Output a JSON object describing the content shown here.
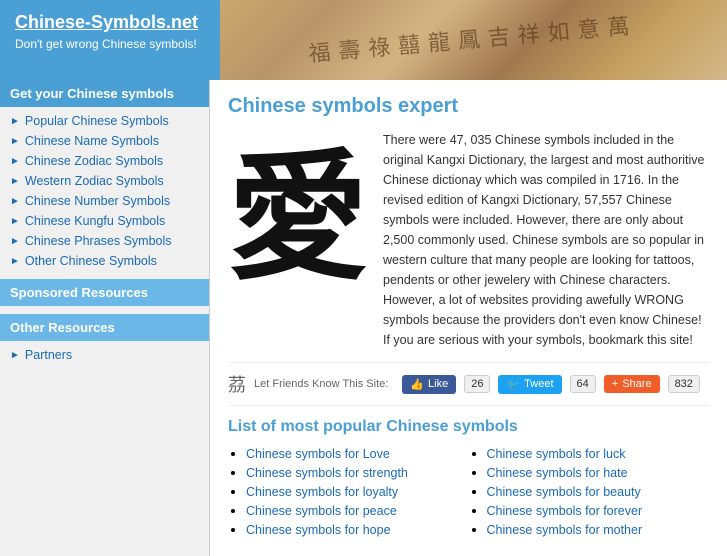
{
  "header": {
    "site_title": "Chinese-Symbols.net",
    "site_tagline": "Don't get wrong Chinese symbols!",
    "banner_chars": "福壽祿囍龍鳳吉祥如意萬"
  },
  "sidebar": {
    "nav_header": "Get your Chinese symbols",
    "nav_items": [
      {
        "label": "Popular Chinese Symbols"
      },
      {
        "label": "Chinese Name Symbols"
      },
      {
        "label": "Chinese Zodiac Symbols"
      },
      {
        "label": "Western Zodiac Symbols"
      },
      {
        "label": "Chinese Number Symbols"
      },
      {
        "label": "Chinese Kungfu Symbols"
      },
      {
        "label": "Chinese Phrases Symbols"
      },
      {
        "label": "Other Chinese Symbols"
      }
    ],
    "sponsored_header": "Sponsored Resources",
    "other_header": "Other Resources",
    "other_items": [
      {
        "label": "Partners"
      }
    ]
  },
  "main": {
    "page_title": "Chinese symbols expert",
    "description": "There were 47, 035 Chinese symbols included in the original Kangxi Dictionary, the largest and most authoritive Chinese dictionay which was compiled in 1716. In the revised edition of Kangxi Dictionary, 57,557 Chinese symbols were included. However, there are only about 2,500 commonly used. Chinese symbols are so popular in western culture that many people are looking for tattoos, pendents or other jewelery with Chinese characters. However, a lot of websites providing awefully WRONG symbols because the providers don't even know Chinese! If you are serious with your symbols, bookmark this site!",
    "chinese_char": "愛",
    "social": {
      "char": "茘",
      "label": "Let Friends Know This Site:",
      "like_label": "Like",
      "like_count": "26",
      "tweet_label": "Tweet",
      "tweet_count": "64",
      "share_label": "Share",
      "share_count": "832"
    },
    "list_title": "List of most popular Chinese symbols",
    "list_left": [
      {
        "text": "Chinese symbols for Love",
        "href": "#"
      },
      {
        "text": "Chinese symbols for strength",
        "href": "#"
      },
      {
        "text": "Chinese symbols for loyalty",
        "href": "#"
      },
      {
        "text": "Chinese symbols for peace",
        "href": "#"
      },
      {
        "text": "Chinese symbols for hope",
        "href": "#"
      }
    ],
    "list_right": [
      {
        "text": "Chinese symbols for luck",
        "href": "#"
      },
      {
        "text": "Chinese symbols for hate",
        "href": "#"
      },
      {
        "text": "Chinese symbols for beauty",
        "href": "#"
      },
      {
        "text": "Chinese symbols for forever",
        "href": "#"
      },
      {
        "text": "Chinese symbols for mother",
        "href": "#"
      }
    ]
  }
}
